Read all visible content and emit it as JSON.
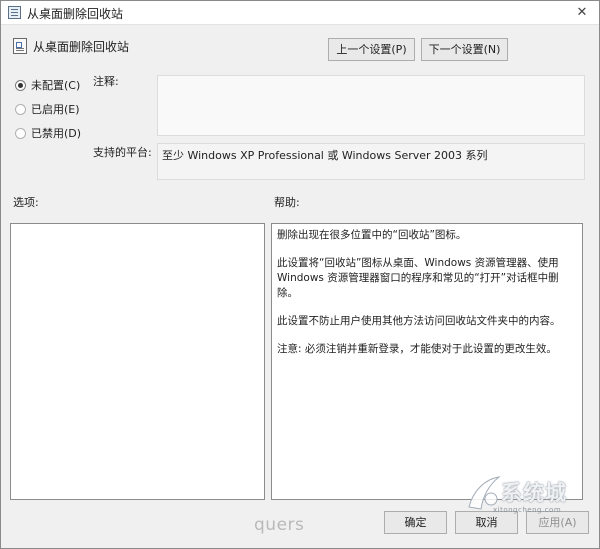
{
  "window": {
    "title": "从桌面删除回收站",
    "close_glyph": "✕"
  },
  "setting": {
    "name": "从桌面删除回收站"
  },
  "nav": {
    "prev_label": "上一个设置(P)",
    "next_label": "下一个设置(N)"
  },
  "state": {
    "options": [
      {
        "label": "未配置(C)",
        "checked": true
      },
      {
        "label": "已启用(E)",
        "checked": false
      },
      {
        "label": "已禁用(D)",
        "checked": false
      }
    ]
  },
  "comment": {
    "label": "注释:",
    "value": ""
  },
  "platform": {
    "label": "支持的平台:",
    "value": "至少 Windows XP Professional 或 Windows Server 2003 系列"
  },
  "options_panel": {
    "label": "选项:"
  },
  "help_panel": {
    "label": "帮助:",
    "paragraphs": [
      "删除出现在很多位置中的“回收站”图标。",
      "此设置将“回收站”图标从桌面、Windows 资源管理器、使用 Windows 资源管理器窗口的程序和常见的“打开”对话框中删除。",
      "此设置不防止用户使用其他方法访问回收站文件夹中的内容。",
      "注意: 必须注销并重新登录，才能使对于此设置的更改生效。"
    ]
  },
  "footer": {
    "ok_label": "确定",
    "cancel_label": "取消",
    "apply_label": "应用(A)"
  },
  "watermarks": {
    "quers": "quers",
    "site": "系统城",
    "site_url": "xitongcheng.com"
  }
}
